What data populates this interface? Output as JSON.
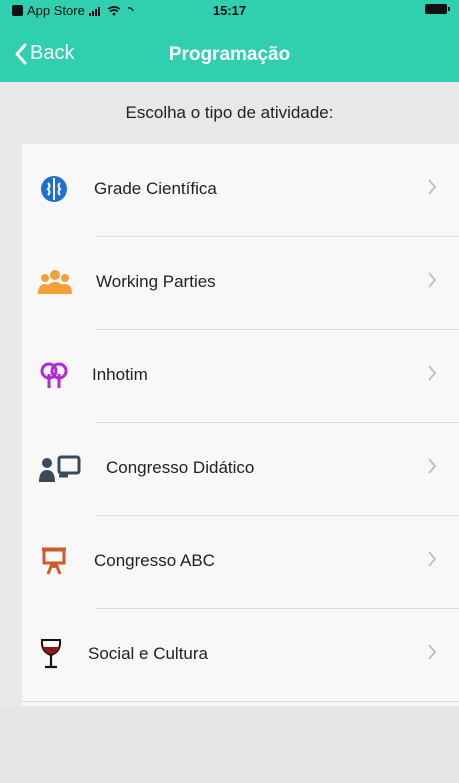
{
  "statusbar": {
    "carrier": "App Store",
    "time": "15:17"
  },
  "nav": {
    "back_label": "Back",
    "title": "Programação"
  },
  "prompt": "Escolha o tipo de atividade:",
  "activities": [
    {
      "label": "Grade Científica",
      "icon": "brain-icon",
      "color": "#1f6fd1"
    },
    {
      "label": "Working Parties",
      "icon": "group-icon",
      "color": "#f4a038"
    },
    {
      "label": "Inhotim",
      "icon": "trees-icon",
      "color": "#b02bd8"
    },
    {
      "label": "Congresso Didático",
      "icon": "teacher-icon",
      "color": "#3a4a5a"
    },
    {
      "label": "Congresso ABC",
      "icon": "easel-icon",
      "color": "#d0582a"
    },
    {
      "label": "Social e Cultura",
      "icon": "wine-glass-icon",
      "color": "#8a1a1a"
    }
  ],
  "colors": {
    "accent": "#2fcfb0"
  }
}
